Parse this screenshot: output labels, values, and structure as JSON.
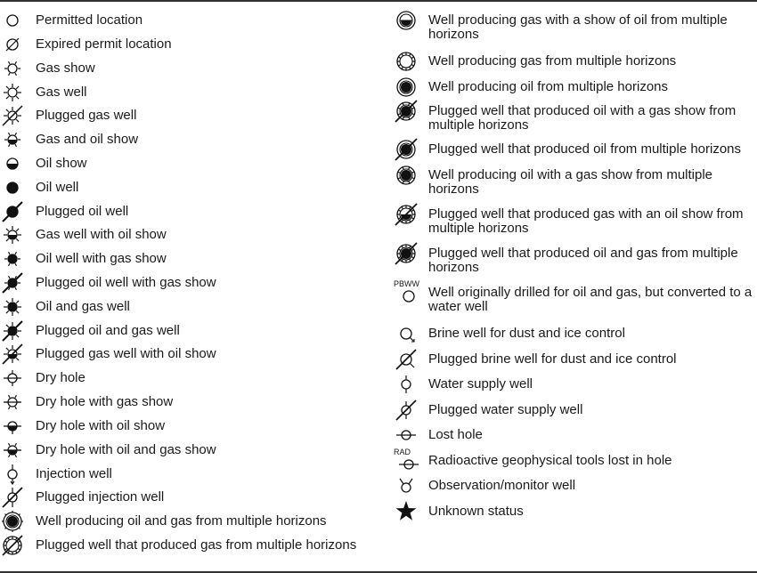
{
  "legend": {
    "left": [
      {
        "icon": "open-circle-icon",
        "label": "Permitted location"
      },
      {
        "icon": "slashed-circle-icon",
        "label": "Expired permit location"
      },
      {
        "icon": "gas-show-icon",
        "label": "Gas show"
      },
      {
        "icon": "gas-well-icon",
        "label": "Gas well"
      },
      {
        "icon": "plugged-gas-well-icon",
        "label": "Plugged gas well"
      },
      {
        "icon": "gas-and-oil-show-icon",
        "label": "Gas and oil show"
      },
      {
        "icon": "oil-show-icon",
        "label": "Oil show"
      },
      {
        "icon": "oil-well-icon",
        "label": "Oil well"
      },
      {
        "icon": "plugged-oil-well-icon",
        "label": "Plugged oil well"
      },
      {
        "icon": "gas-well-with-oil-show-icon",
        "label": "Gas well with oil show"
      },
      {
        "icon": "oil-well-with-gas-show-icon",
        "label": "Oil well with gas show"
      },
      {
        "icon": "plugged-oil-well-with-gas-show-icon",
        "label": "Plugged oil well with gas show"
      },
      {
        "icon": "oil-and-gas-well-icon",
        "label": "Oil and gas well"
      },
      {
        "icon": "plugged-oil-and-gas-well-icon",
        "label": "Plugged oil and gas well"
      },
      {
        "icon": "plugged-gas-well-with-oil-show-icon",
        "label": "Plugged gas well with oil show"
      },
      {
        "icon": "dry-hole-icon",
        "label": "Dry hole"
      },
      {
        "icon": "dry-hole-with-gas-show-icon",
        "label": "Dry hole with gas show"
      },
      {
        "icon": "dry-hole-with-oil-show-icon",
        "label": "Dry hole with oil show"
      },
      {
        "icon": "dry-hole-with-oil-and-gas-show-icon",
        "label": "Dry hole with oil and gas show"
      },
      {
        "icon": "injection-well-icon",
        "label": "Injection well"
      },
      {
        "icon": "plugged-injection-well-icon",
        "label": "Plugged injection well"
      },
      {
        "icon": "multi-horizon-oil-gas-well-icon",
        "label": "Well producing oil and gas from multiple horizons"
      },
      {
        "icon": "plugged-multi-horizon-gas-well-icon",
        "label": "Plugged well that produced gas from multiple horizons"
      }
    ],
    "right": [
      {
        "icon": "multi-horizon-gas-with-oil-show-icon",
        "label": "Well producing gas with a show of oil from multiple horizons"
      },
      {
        "icon": "multi-horizon-gas-well-icon",
        "label": "Well producing gas from multiple horizons"
      },
      {
        "icon": "multi-horizon-oil-well-icon",
        "label": "Well producing oil from multiple horizons"
      },
      {
        "icon": "plugged-multi-horizon-oil-with-gas-show-icon",
        "label": "Plugged well that produced oil with a gas show from multiple horizons"
      },
      {
        "icon": "plugged-multi-horizon-oil-well-icon",
        "label": "Plugged well that produced oil from multiple horizons"
      },
      {
        "icon": "multi-horizon-oil-with-gas-show-icon",
        "label": "Well producing oil with a gas show from multiple horizons"
      },
      {
        "icon": "plugged-multi-horizon-gas-with-oil-show-icon",
        "label": "Plugged well that produced gas with an oil show from multiple horizons"
      },
      {
        "icon": "plugged-multi-horizon-oil-and-gas-icon",
        "label": "Plugged well that produced oil and gas from multiple horizons"
      },
      {
        "icon": "converted-water-well-icon",
        "prefix": "PBWW",
        "label": "Well originally drilled for oil and gas, but converted to a water well"
      },
      {
        "icon": "brine-well-icon",
        "label": "Brine well for dust and ice control"
      },
      {
        "icon": "plugged-brine-well-icon",
        "label": "Plugged brine well for dust and ice control"
      },
      {
        "icon": "water-supply-well-icon",
        "label": "Water supply well"
      },
      {
        "icon": "plugged-water-supply-well-icon",
        "label": "Plugged water supply well"
      },
      {
        "icon": "lost-hole-icon",
        "label": "Lost hole"
      },
      {
        "icon": "radioactive-tools-lost-icon",
        "prefix": "RAD",
        "label": "Radioactive geophysical tools lost in hole"
      },
      {
        "icon": "observation-well-icon",
        "label": "Observation/monitor well"
      },
      {
        "icon": "star-icon",
        "label": "Unknown status"
      }
    ]
  }
}
